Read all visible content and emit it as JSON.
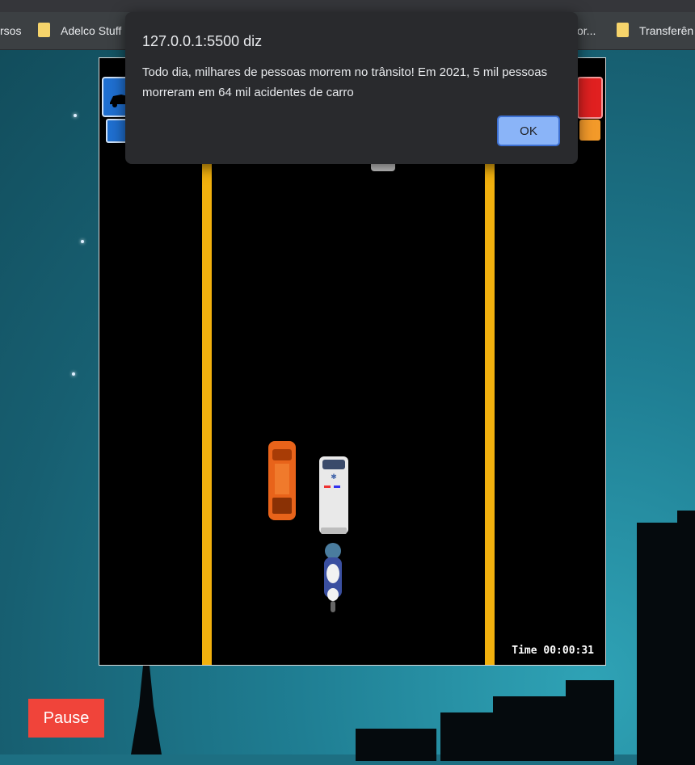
{
  "bookmarks": {
    "items": [
      "rsos",
      "Adelco Stuff",
      "or...",
      "Transferên"
    ]
  },
  "dialog": {
    "title": "127.0.0.1:5500 diz",
    "message": "Todo dia, milhares de pessoas morrem no trânsito! Em 2021, 5 mil pessoas morreram em 64 mil acidentes de carro",
    "ok_label": "OK"
  },
  "game": {
    "timer": "Time 00:00:31",
    "vehicles": [
      "orange-car",
      "ambulance",
      "motorcycle",
      "white-car"
    ]
  },
  "controls": {
    "pause_label": "Pause"
  },
  "colors": {
    "lane_line": "#f2b10e",
    "pause_button": "#f0443a",
    "ok_button": "#8ab4f8",
    "dialog_bg": "#292a2d"
  }
}
